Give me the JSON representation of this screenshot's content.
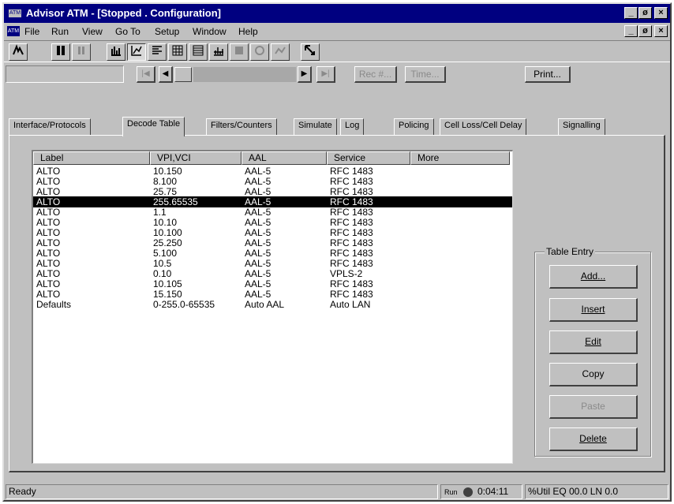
{
  "window": {
    "title": "Advisor ATM - [Stopped . Configuration]",
    "logo": "ATM",
    "controls": [
      "_",
      "ø",
      "×"
    ]
  },
  "menubar": {
    "items": [
      "File",
      "Run",
      "View",
      "Go To",
      "Setup",
      "Window",
      "Help"
    ]
  },
  "toolbar": {
    "icons": [
      "signal-icon",
      "stop-icon",
      "pause-icon",
      "bar-chart-icon",
      "stats-icon",
      "list-icon",
      "grid-icon",
      "decode-icon",
      "histogram-icon",
      "record-icon",
      "capture-icon",
      "graph-icon",
      "pointer-icon"
    ]
  },
  "navigation": {
    "first_label": "|◀",
    "prev_label": "◀",
    "next_label": "▶",
    "last_label": "▶|",
    "rec_label": "Rec #...",
    "time_label": "Time...",
    "print_label": "Print..."
  },
  "tabs": [
    "Interface/Protocols",
    "Decode Table",
    "Filters/Counters",
    "Simulate",
    "Log",
    "Policing",
    "Cell Loss/Cell Delay",
    "Signalling"
  ],
  "active_tab": "Decode Table",
  "table": {
    "columns": [
      "Label",
      "VPI,VCI",
      "AAL",
      "Service",
      "More"
    ],
    "rows": [
      [
        "ALTO",
        "10.150",
        "AAL-5",
        "RFC 1483",
        ""
      ],
      [
        "ALTO",
        "8.100",
        "AAL-5",
        "RFC 1483",
        ""
      ],
      [
        "ALTO",
        "25.75",
        "AAL-5",
        "RFC 1483",
        ""
      ],
      [
        "ALTO",
        "255.65535",
        "AAL-5",
        "RFC 1483",
        ""
      ],
      [
        "ALTO",
        "1.1",
        "AAL-5",
        "RFC 1483",
        ""
      ],
      [
        "ALTO",
        "10.10",
        "AAL-5",
        "RFC 1483",
        ""
      ],
      [
        "ALTO",
        "10.100",
        "AAL-5",
        "RFC 1483",
        ""
      ],
      [
        "ALTO",
        "25.250",
        "AAL-5",
        "RFC 1483",
        ""
      ],
      [
        "ALTO",
        "5.100",
        "AAL-5",
        "RFC 1483",
        ""
      ],
      [
        "ALTO",
        "10.5",
        "AAL-5",
        "RFC 1483",
        ""
      ],
      [
        "ALTO",
        "0.10",
        "AAL-5",
        "VPLS-2",
        ""
      ],
      [
        "ALTO",
        "10.105",
        "AAL-5",
        "RFC 1483",
        ""
      ],
      [
        "ALTO",
        "15.150",
        "AAL-5",
        "RFC 1483",
        ""
      ],
      [
        "Defaults",
        "0-255.0-65535",
        "Auto AAL",
        "Auto LAN",
        ""
      ]
    ],
    "selected_row": 3
  },
  "table_entry": {
    "title": "Table Entry",
    "add": "Add...",
    "insert": "Insert",
    "edit": "Edit",
    "copy": "Copy",
    "paste": "Paste",
    "delete": "Delete"
  },
  "statusbar": {
    "status": "Ready",
    "run_label": "Run",
    "time": "0:04:11",
    "info": "%Util EQ 00.0 LN 0.0"
  }
}
